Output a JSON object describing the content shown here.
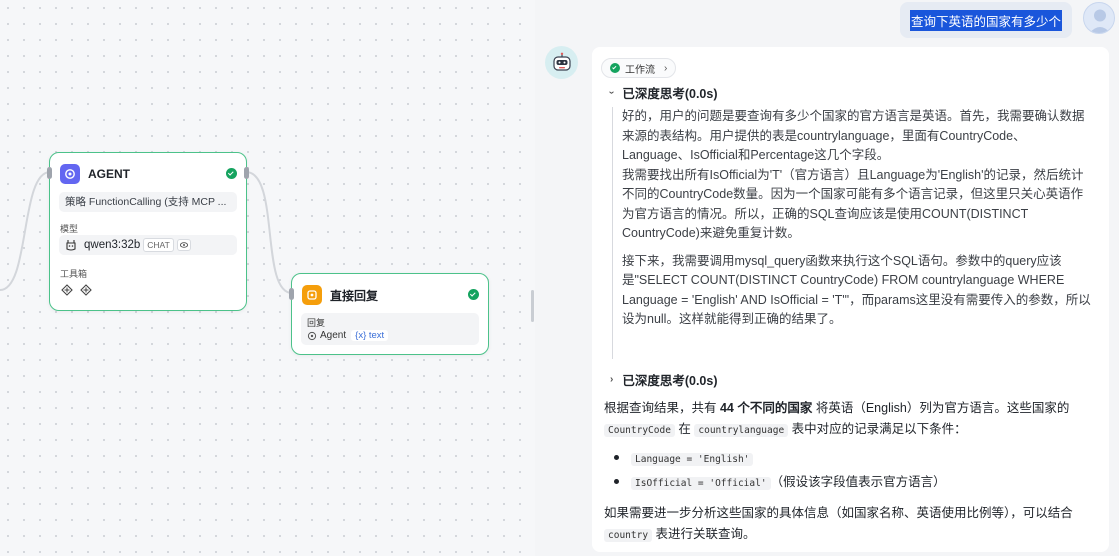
{
  "canvas": {
    "agent_node": {
      "title": "AGENT",
      "strategy": "策略 FunctionCalling (支持 MCP ...",
      "model_label": "模型",
      "model_name": "qwen3:32b",
      "model_tag": "CHAT",
      "tools_label": "工具箱"
    },
    "reply_node": {
      "title": "直接回复",
      "reply_label": "回复",
      "source_name": "Agent",
      "var_tag": "{x} text"
    }
  },
  "chat": {
    "user_message": "查询下英语的国家有多少个",
    "workflow_label": "工作流",
    "thinking_label_1": "已深度思考(0.0s)",
    "thinking_label_2": "已深度思考(0.0s)",
    "thinking_paragraphs": [
      "好的，用户的问题是要查询有多少个国家的官方语言是英语。首先，我需要确认数据来源的表结构。用户提供的表是countrylanguage，里面有CountryCode、Language、IsOfficial和Percentage这几个字段。",
      "我需要找出所有IsOfficial为'T'（官方语言）且Language为'English'的记录，然后统计不同的CountryCode数量。因为一个国家可能有多个语言记录，但这里只关心英语作为官方语言的情况。所以，正确的SQL查询应该是使用COUNT(DISTINCT CountryCode)来避免重复计数。",
      "接下来，我需要调用mysql_query函数来执行这个SQL语句。参数中的query应该是\"SELECT COUNT(DISTINCT CountryCode) FROM countrylanguage WHERE Language = 'English' AND IsOfficial = 'T'\"，而params这里没有需要传入的参数，所以设为null。这样就能得到正确的结果了。"
    ],
    "answer": {
      "line1_a": "根据查询结果，共有 ",
      "line1_bold": "44 个不同的国家",
      "line1_b": " 将英语（English）列为官方语言。这些国家的",
      "code_country_code": "CountryCode",
      "text_in": " 在 ",
      "code_table": "countrylanguage",
      "text_conditions": " 表中对应的记录满足以下条件：",
      "bullet1_code": "Language = 'English'",
      "bullet2_code": "IsOfficial = 'Official'",
      "bullet2_note": "（假设该字段值表示官方语言）",
      "footer_a": "如果需要进一步分析这些国家的具体信息（如国家名称、英语使用比例等），可以结合",
      "code_country": "country",
      "footer_b": " 表进行关联查询。"
    }
  },
  "colors": {
    "node_border": "#4cc28a",
    "agent_icon": "#6366f1",
    "reply_icon": "#f59e0b",
    "success": "#15a35f",
    "user_highlight": "#1a56db"
  }
}
